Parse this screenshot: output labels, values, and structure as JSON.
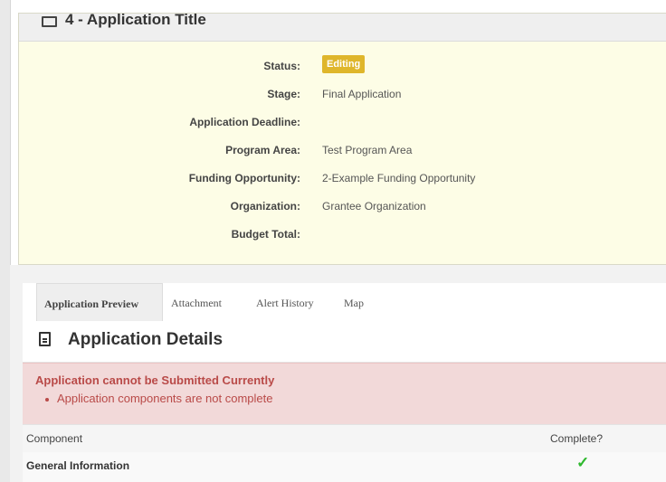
{
  "application": {
    "title": "4 - Application Title",
    "fields": [
      {
        "label": "Status:",
        "value": "Editing"
      },
      {
        "label": "Stage:",
        "value": "Final Application"
      },
      {
        "label": "Application Deadline:",
        "value": ""
      },
      {
        "label": "Program Area:",
        "value": "Test Program Area"
      },
      {
        "label": "Funding Opportunity:",
        "value": "2-Example Funding Opportunity"
      },
      {
        "label": "Organization:",
        "value": "Grantee Organization"
      },
      {
        "label": "Budget Total:",
        "value": ""
      }
    ],
    "status_color": "#dfb62b"
  },
  "tabs": [
    {
      "label": "Application Preview",
      "active": true
    },
    {
      "label": "Attachment",
      "active": false
    },
    {
      "label": "Alert History",
      "active": false
    },
    {
      "label": "Map",
      "active": false
    }
  ],
  "details": {
    "title": "Application Details",
    "icon": "document-icon"
  },
  "alert": {
    "title": "Application cannot be Submitted Currently",
    "items": [
      "Application components are not complete"
    ],
    "color": "#b94a48"
  },
  "table": {
    "headers": [
      "Component",
      "Complete?"
    ],
    "rows": [
      {
        "component": "General Information",
        "complete": "✓"
      }
    ]
  }
}
